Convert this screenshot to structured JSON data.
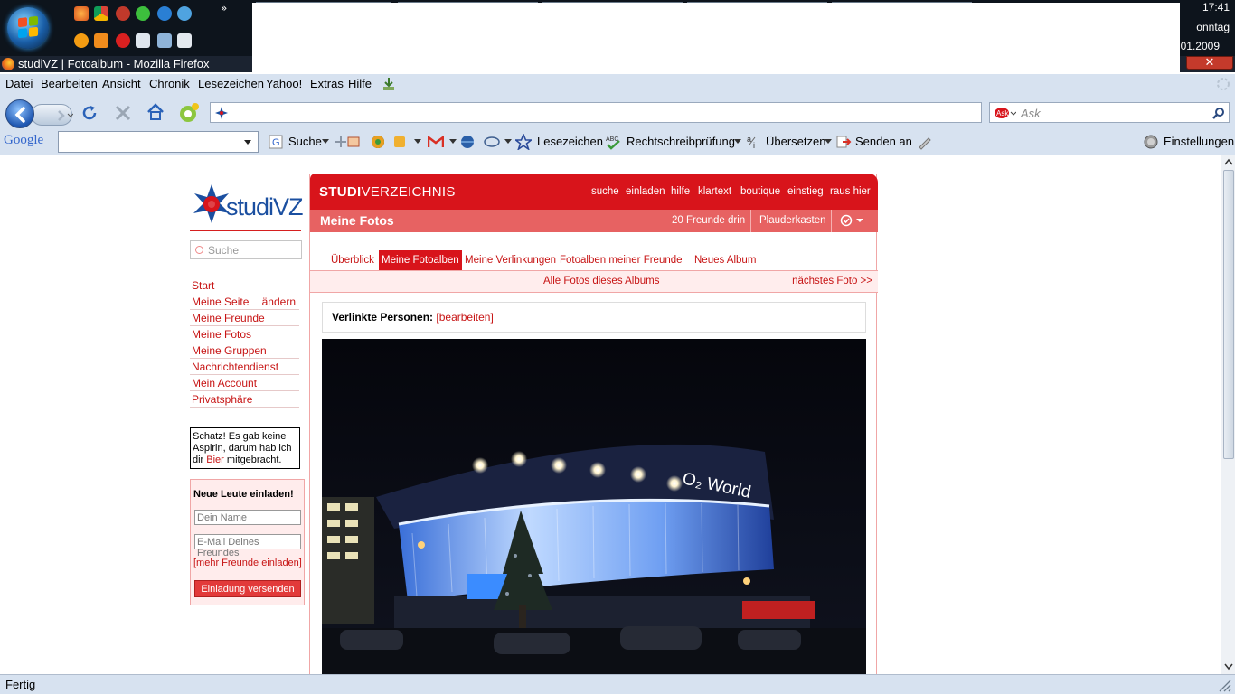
{
  "taskbar": {
    "clock_time": "17:41",
    "clock_day": "onntag",
    "clock_date": ".01.2009",
    "tray_chevron": "»"
  },
  "window": {
    "title": "studiVZ | Fotoalbum - Mozilla Firefox",
    "close_glyph": "✕"
  },
  "menu": {
    "items": [
      "Datei",
      "Bearbeiten",
      "Ansicht",
      "Chronik",
      "Lesezeichen",
      "Yahoo!",
      "Extras",
      "Hilfe"
    ]
  },
  "navbar": {
    "url_value": "",
    "search_placeholder": "Ask"
  },
  "google_toolbar": {
    "logo": "Google",
    "search_value": "",
    "suche": "Suche",
    "lesezeichen": "Lesezeichen",
    "rechtschreibpruefung": "Rechtschreibprüfung",
    "uebersetzen": "Übersetzen",
    "senden_an": "Senden an",
    "einstellungen": "Einstellungen"
  },
  "studivz": {
    "logo_text": "studiVZ",
    "search_placeholder": "Suche",
    "nav": [
      {
        "label": "Start"
      },
      {
        "label": "Meine Seite",
        "aside": "ändern"
      },
      {
        "label": "Meine Freunde"
      },
      {
        "label": "Meine Fotos"
      },
      {
        "label": "Meine Gruppen"
      },
      {
        "label": "Nachrichtendienst"
      },
      {
        "label": "Mein Account"
      },
      {
        "label": "Privatsphäre"
      }
    ],
    "quote": {
      "part1": "Schatz! Es gab keine Aspirin, darum hab ich dir ",
      "link": "Bier",
      "part2": " mitgebracht."
    },
    "invite": {
      "heading": "Neue Leute einladen!",
      "name_placeholder": "Dein Name",
      "email_placeholder": "E-Mail Deines Freundes",
      "more_link": "[mehr Freunde einladen]",
      "button": "Einladung versenden"
    },
    "header": {
      "brand_bold": "STUDI",
      "brand_rest": "VERZEICHNIS",
      "top_nav": [
        "suche",
        "einladen",
        "hilfe",
        "klartext",
        "boutique",
        "einstieg",
        "raus hier"
      ]
    },
    "subheader": {
      "title": "Meine Fotos",
      "friends_online": "20 Freunde drin",
      "chat": "Plauderkasten"
    },
    "tabs": [
      {
        "label": "Überblick",
        "active": false
      },
      {
        "label": "Meine Fotoalben",
        "active": true
      },
      {
        "label": "Meine Verlinkungen",
        "active": false
      },
      {
        "label": "Fotoalben meiner Freunde",
        "active": false
      },
      {
        "label": "Neues Album",
        "active": false
      }
    ],
    "album_bar": {
      "all_photos": "Alle Fotos dieses Albums",
      "next_photo": "nächstes Foto >>"
    },
    "linked_people": {
      "label": "Verlinkte Personen:",
      "edit": "[bearbeiten]"
    },
    "photo": {
      "sign_text": "O₂ World"
    }
  },
  "status": {
    "text": "Fertig"
  },
  "colors": {
    "brand_red": "#d8141b",
    "link_red": "#c71414",
    "chrome_blue": "#d7e2f0"
  }
}
